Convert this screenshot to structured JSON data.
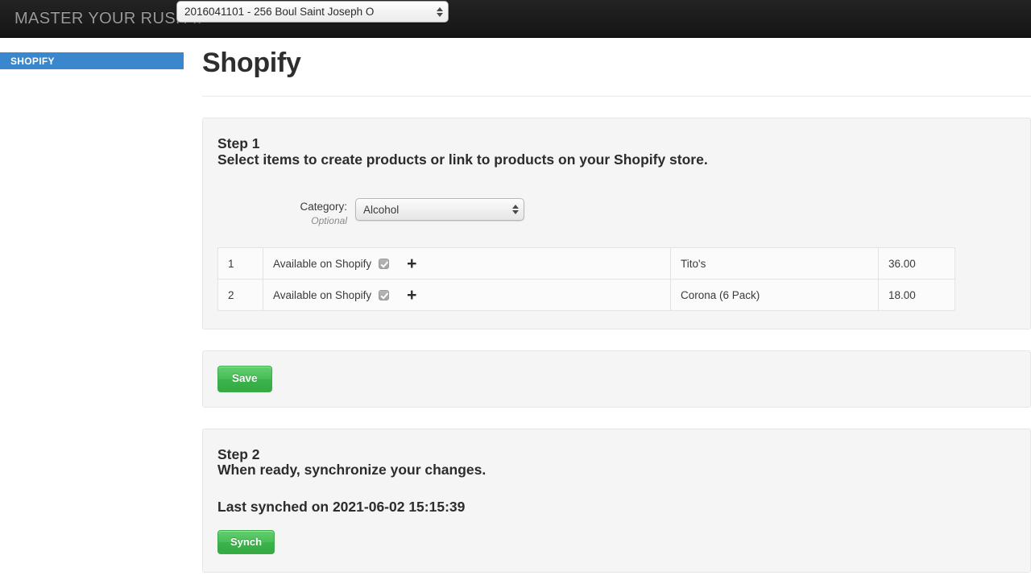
{
  "topbar": {
    "brand": "MASTER YOUR RUSH ::",
    "store_select": {
      "value": "2016041101 - 256 Boul Saint Joseph O",
      "stepper_icon": "stepper-updown-icon"
    }
  },
  "sidebar": {
    "items": [
      {
        "label": "SHOPIFY",
        "active": true
      }
    ],
    "active_color": "#3b87cd"
  },
  "main": {
    "title": "Shopify",
    "step1": {
      "heading": "Step 1",
      "subheading": "Select items to create products or link to products on your Shopify store.",
      "category": {
        "label": "Category:",
        "optional": "Optional",
        "value": "Alcohol",
        "stepper_icon": "stepper-updown-icon"
      },
      "table": {
        "rows": [
          {
            "index": "1",
            "available_label": "Available on Shopify",
            "checked": true,
            "add_icon": "plus-icon",
            "name": "Tito's",
            "price": "36.00"
          },
          {
            "index": "2",
            "available_label": "Available on Shopify",
            "checked": true,
            "add_icon": "plus-icon",
            "name": "Corona (6 Pack)",
            "price": "18.00"
          }
        ]
      }
    },
    "save_panel": {
      "save_label": "Save"
    },
    "step2": {
      "heading": "Step 2",
      "subheading": "When ready, synchronize your changes.",
      "last_synched": "Last synched on 2021-06-02 15:15:39",
      "synch_label": "Synch"
    }
  },
  "colors": {
    "accent_blue": "#3b87cd",
    "button_green": "#49bd57",
    "topbar_dark": "#1b1b1b",
    "panel_bg": "#f5f5f5"
  }
}
